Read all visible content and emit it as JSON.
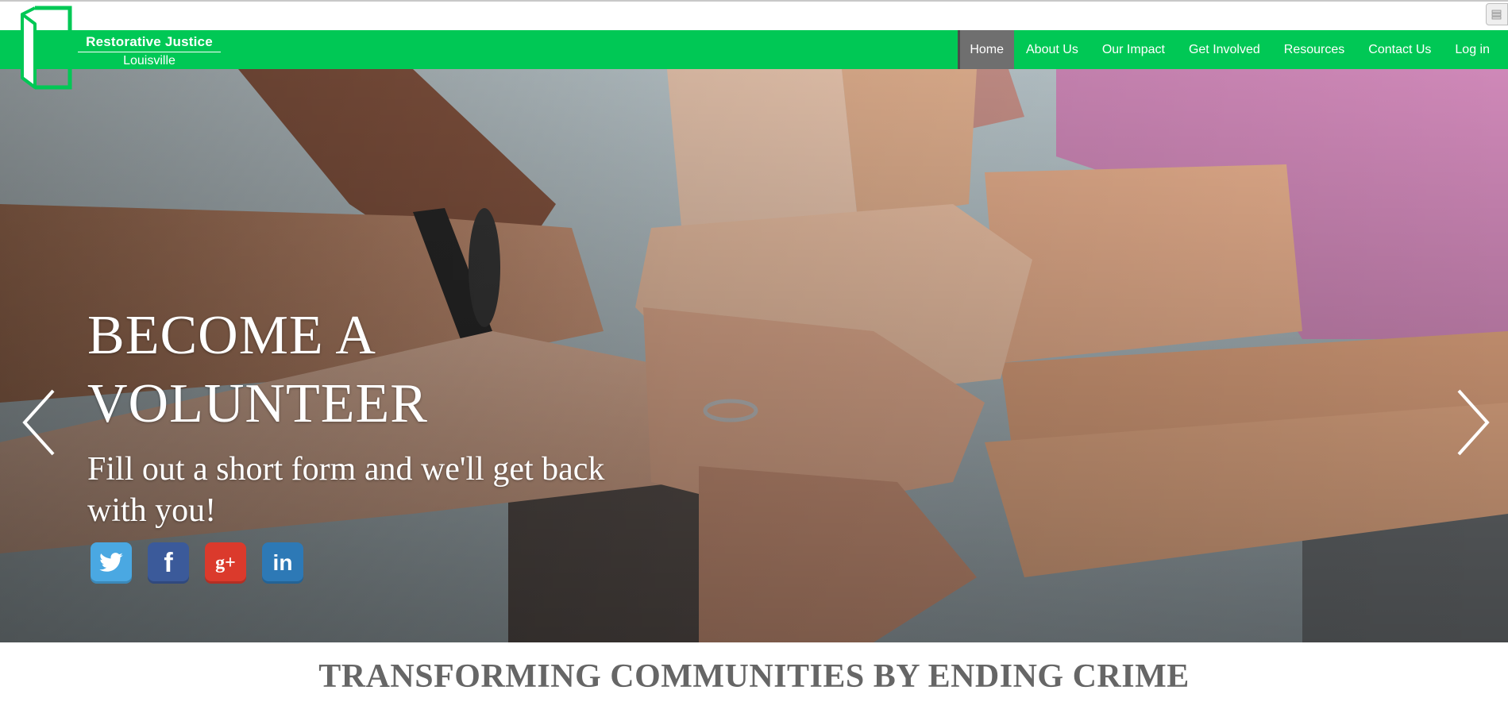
{
  "brand": {
    "name_line1": "Restorative Justice",
    "name_line2": "Louisville",
    "accent_color": "#00c855"
  },
  "nav": {
    "items": [
      {
        "label": "Home",
        "active": true
      },
      {
        "label": "About Us",
        "active": false
      },
      {
        "label": "Our Impact",
        "active": false
      },
      {
        "label": "Get Involved",
        "active": false
      },
      {
        "label": "Resources",
        "active": false
      },
      {
        "label": "Contact Us",
        "active": false
      },
      {
        "label": "Log in",
        "active": false
      }
    ]
  },
  "hero": {
    "title": "BECOME A VOLUNTEER",
    "subtitle": "Fill out a short form and we'll get back with you!",
    "image": "stacked-hands-teamwork",
    "socials": [
      {
        "name": "twitter-icon",
        "glyph": "twitter",
        "color": "#4aa8e2"
      },
      {
        "name": "facebook-icon",
        "glyph": "f",
        "color": "#3b5a9a"
      },
      {
        "name": "google-plus-icon",
        "glyph": "g+",
        "color": "#db3a2c"
      },
      {
        "name": "linkedin-icon",
        "glyph": "in",
        "color": "#2d79b6"
      }
    ],
    "prev_icon": "chevron-left-icon",
    "next_icon": "chevron-right-icon"
  },
  "main": {
    "headline": "TRANSFORMING COMMUNITIES BY ENDING CRIME"
  }
}
